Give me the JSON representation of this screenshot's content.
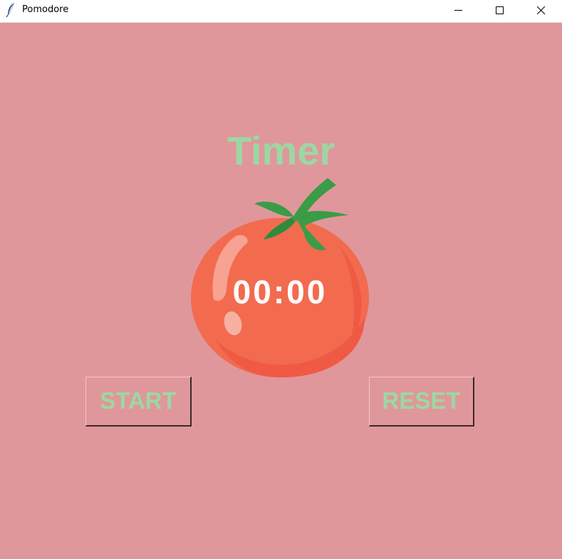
{
  "window": {
    "title": "Pomodore",
    "app_icon": "feather-icon",
    "controls": [
      "minimize-icon",
      "maximize-icon",
      "close-icon"
    ]
  },
  "colors": {
    "background": "#e0979b",
    "label_green": "#9bd8a3",
    "tomato_red": "#f26b4f",
    "leaf_green": "#3a9c46",
    "time_text": "#ffffff"
  },
  "main": {
    "title": "Timer",
    "time": "00:00",
    "tomato_image": "tomato-icon"
  },
  "buttons": {
    "start_label": "START",
    "reset_label": "RESET"
  }
}
